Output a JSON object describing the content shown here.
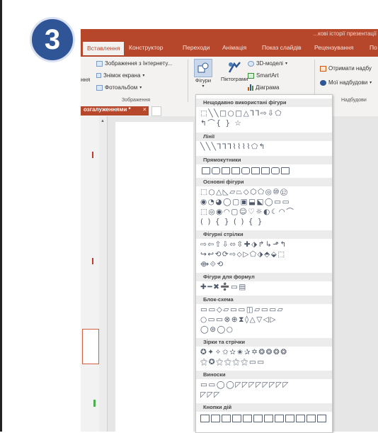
{
  "step_number": "3",
  "window": {
    "title": "...кові історії презентації"
  },
  "tabs": [
    {
      "label": "Вставлення",
      "active": true
    },
    {
      "label": "Конструктор"
    },
    {
      "label": "Переходи"
    },
    {
      "label": "Анімація"
    },
    {
      "label": "Показ слайдів"
    },
    {
      "label": "Рецензування"
    },
    {
      "label": "По"
    }
  ],
  "ribbon": {
    "cut_label": "ння",
    "images_group": {
      "online_images": "Зображення з Інтернету...",
      "screenshot": "Знімок екрана",
      "photo_album": "Фотоальбом",
      "group_label": "Зображення"
    },
    "illustrations_group": {
      "shapes": "Фігури",
      "icons": "Піктограми",
      "models_3d": "3D-моделі",
      "smartart": "SmartArt",
      "chart": "Діаграма"
    },
    "addins_group": {
      "get_addins": "Отримати надбу",
      "my_addins": "Мої надбудови",
      "group_label": "Надбудови"
    }
  },
  "document_tab": {
    "label": "озгалуженнями *",
    "close": "×"
  },
  "shapes_menu": {
    "sections": [
      {
        "title": "Нещодавно використані фігури",
        "rows": [
          "⬚╲╲□○□△⅂⅂⇨⇩⬠",
          "↰⌒{ } ☆"
        ]
      },
      {
        "title": "Лінії",
        "rows": [
          "╲╲╲⅂⅂⅂⌇⌇⌇⌇⬠↰"
        ]
      },
      {
        "title": "Прямокутники",
        "rows": []
      },
      {
        "title": "Основні фігури",
        "rows": [
          "⬚○△◺▱⏢◇⬡⬠◎⑩⑫",
          "◉◔◕◯▢▣⬓⬕◯▭▭",
          "⬚◎◉◠▢☺♡☼◐☾◠⌒",
          "( ) { } ( ) { }"
        ]
      },
      {
        "title": "Фігурні стрілки",
        "rows": [
          "⇨⇦⇧⇩⬄⇳✚⬗↱↳⬏↰",
          "↪↩⟲⟳⇨⬦▷⬠⬗⬘⬙⬚",
          "⟴⟐⟲"
        ]
      },
      {
        "title": "Фігури для формул",
        "rows": [
          "✚━✖➗▭▤"
        ]
      },
      {
        "title": "Блок-схема",
        "rows": [
          "▭▭◇▱▭▭◫▱▭▭▱",
          "○▭▭⊗⊕⧗◊△▽◁▷",
          "◯⊜◯○"
        ]
      },
      {
        "title": "Зірки та стрічки",
        "rows": [
          "✪✦✧✩✫✬✰✡❂❂❂❂",
          "⚝✪⚝⚝⚝⚝▭▭"
        ]
      },
      {
        "title": "Виноски",
        "rows": [
          "▭▭◯◯◸◸◸◸◸◸◸◸",
          "◸◸◸"
        ]
      },
      {
        "title": "Кнопки дій",
        "rows": []
      }
    ]
  },
  "colors": {
    "accent": "#b7472a",
    "step_badge": "#2f5597"
  }
}
